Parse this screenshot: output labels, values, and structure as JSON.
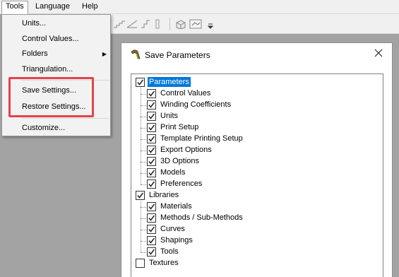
{
  "menubar": {
    "items": [
      {
        "label": "Tools"
      },
      {
        "label": "Language"
      },
      {
        "label": "Help"
      }
    ]
  },
  "tools_menu": {
    "items": [
      {
        "label": "Units..."
      },
      {
        "label": "Control Values..."
      },
      {
        "label": "Folders",
        "submenu": true
      },
      {
        "label": "Triangulation..."
      },
      {
        "label": "Save Settings..."
      },
      {
        "label": "Restore Settings..."
      },
      {
        "label": "Customize..."
      }
    ],
    "highlight_color": "#e2434b"
  },
  "dialog": {
    "title": "Save Parameters",
    "groups": [
      {
        "label": "Parameters",
        "checked": true,
        "selected": true,
        "children": [
          {
            "label": "Control Values",
            "checked": true
          },
          {
            "label": "Winding Coefficients",
            "checked": true
          },
          {
            "label": "Units",
            "checked": true
          },
          {
            "label": "Print Setup",
            "checked": true
          },
          {
            "label": "Template Printing Setup",
            "checked": true
          },
          {
            "label": "Export Options",
            "checked": true
          },
          {
            "label": "3D Options",
            "checked": true
          },
          {
            "label": "Models",
            "checked": true
          },
          {
            "label": "Preferences",
            "checked": true
          }
        ]
      },
      {
        "label": "Libraries",
        "checked": true,
        "children": [
          {
            "label": "Materials",
            "checked": true
          },
          {
            "label": "Methods / Sub-Methods",
            "checked": true
          },
          {
            "label": "Curves",
            "checked": true
          },
          {
            "label": "Shapings",
            "checked": true
          },
          {
            "label": "Tools",
            "checked": true
          }
        ]
      },
      {
        "label": "Textures",
        "checked": false,
        "children": []
      }
    ]
  },
  "colors": {
    "selection": "#0078d7",
    "workspace": "#a3a3a3"
  }
}
